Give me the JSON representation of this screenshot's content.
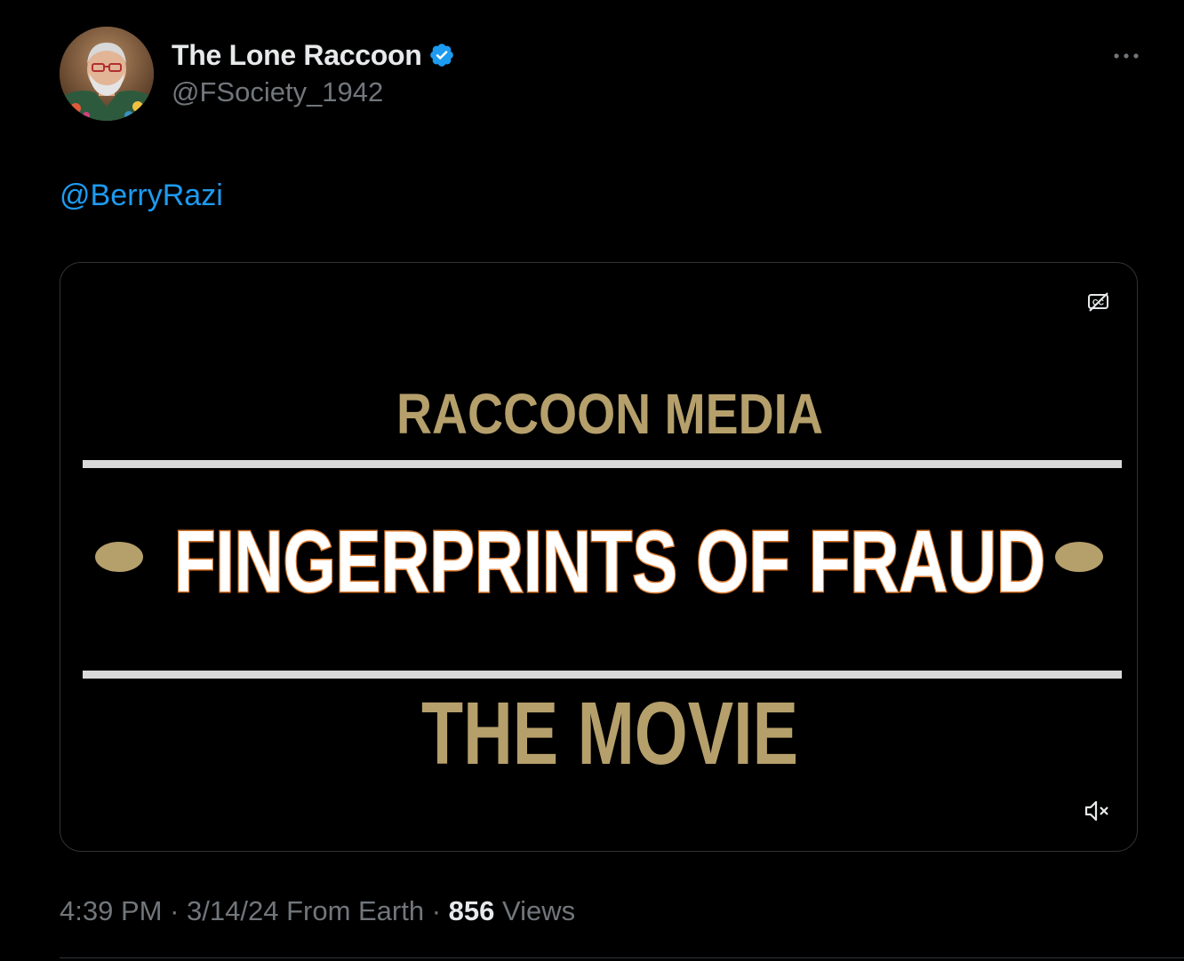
{
  "author": {
    "display_name": "The Lone Raccoon",
    "handle": "@FSociety_1942",
    "verified": true
  },
  "tweet": {
    "mention": "@BerryRazi"
  },
  "media": {
    "kicker": "RACCOON MEDIA",
    "title": "FINGERPRINTS OF FRAUD",
    "subtitle": "THE MOVIE",
    "cc_icon": "closed-captions-off-icon",
    "mute_icon": "speaker-muted-icon"
  },
  "meta": {
    "time": "4:39 PM",
    "separator1": " · ",
    "date": "3/14/24",
    "source": " From Earth",
    "separator2": " · ",
    "views_count": "856",
    "views_label": " Views"
  },
  "colors": {
    "background": "#000000",
    "link": "#1d9bf0",
    "muted_text": "#71767b",
    "primary_text": "#e7e9ea",
    "gold": "#b59f6b",
    "title_outline": "#d9762a",
    "divider_line": "#d9d9d9"
  },
  "icons": {
    "more": "more-horizontal-icon",
    "verified": "verified-badge-icon"
  }
}
